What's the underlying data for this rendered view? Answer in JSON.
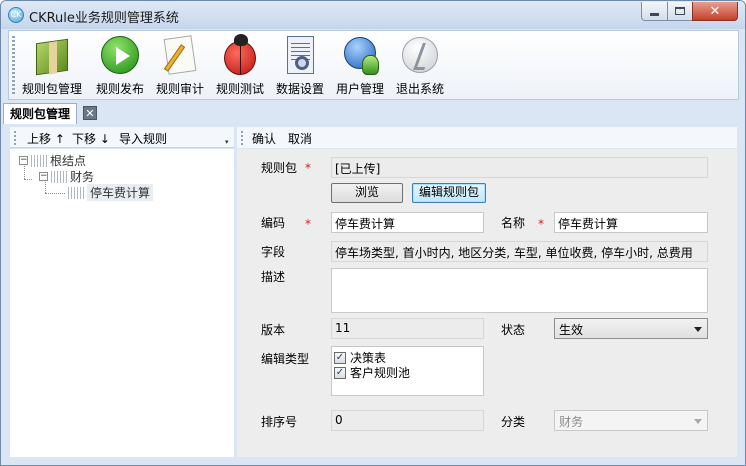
{
  "window": {
    "title": "CKRule业务规则管理系统",
    "app_icon_text": "CK",
    "close_glyph": "✕"
  },
  "toolbar": {
    "items": [
      {
        "label": "规则包管理",
        "icon": "package-icon"
      },
      {
        "label": "规则发布",
        "icon": "play-icon"
      },
      {
        "label": "规则审计",
        "icon": "audit-icon"
      },
      {
        "label": "规则测试",
        "icon": "bug-icon"
      },
      {
        "label": "数据设置",
        "icon": "data-settings-icon"
      },
      {
        "label": "用户管理",
        "icon": "user-icon"
      },
      {
        "label": "退出系统",
        "icon": "exit-icon"
      }
    ]
  },
  "tabs": {
    "active_label": "规则包管理",
    "close_glyph": "✕"
  },
  "left": {
    "toolbar": {
      "move_up": "上移 ↑",
      "move_down": "下移 ↓",
      "import": "导入规则"
    },
    "tree": {
      "root": "根结点",
      "child": "财务",
      "leaf": "停车费计算",
      "collapse_glyph": "−"
    }
  },
  "right": {
    "toolbar": {
      "confirm": "确认",
      "cancel": "取消"
    },
    "form": {
      "package_label": "规则包",
      "package_value": "[已上传]",
      "browse_button": "浏览",
      "edit_package_button": "编辑规则包",
      "code_label": "编码",
      "code_value": "停车费计算",
      "name_label": "名称",
      "name_value": "停车费计算",
      "fields_label": "字段",
      "fields_value": "停车场类型, 首小时内, 地区分类, 车型, 单位收费, 停车小时, 总费用",
      "desc_label": "描述",
      "desc_value": "",
      "version_label": "版本",
      "version_value": "11",
      "status_label": "状态",
      "status_value": "生效",
      "edit_type_label": "编辑类型",
      "edit_types": [
        {
          "label": "决策表",
          "checked": true
        },
        {
          "label": "客户规则池",
          "checked": true
        }
      ],
      "check_glyph": "✓",
      "sort_label": "排序号",
      "sort_value": "0",
      "category_label": "分类",
      "category_value": "财务",
      "required_mark": "*"
    }
  },
  "colors": {
    "accent": "#3c7fb1",
    "required": "#d42020",
    "window_bg": "#dbe6f4",
    "panel_bg": "#ededed"
  }
}
